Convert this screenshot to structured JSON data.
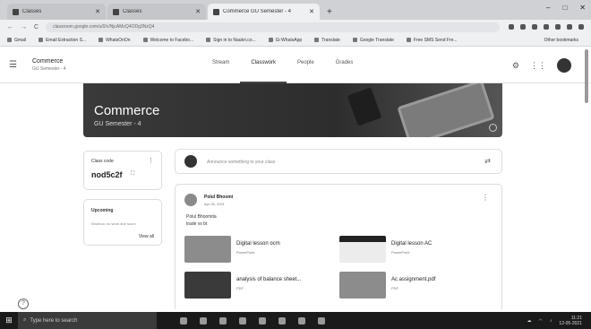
{
  "browser": {
    "tabs": [
      {
        "label": "Classes",
        "active": false
      },
      {
        "label": "Classes",
        "active": false
      },
      {
        "label": "Commerce GU Semester - 4",
        "active": true
      }
    ],
    "new_tab": "+",
    "window_controls": {
      "minimize": "–",
      "maximize": "□",
      "close": "✕"
    },
    "nav": {
      "back": "←",
      "forward": "→",
      "reload": "C"
    },
    "url": "classroom.google.com/u/0/c/NjcAMzQ4ODg3NzQ4",
    "bookmarks": [
      "Gmail",
      "Email Extraction S...",
      "WhatsOnOn",
      "Welcome to Facebo...",
      "Sign in to Naukri.co...",
      "Gi WhatsApp",
      "Translate",
      "Google Translate",
      "Free SMS Send Fre..."
    ],
    "other_bookmarks": "Other bookmarks"
  },
  "classroom": {
    "class_name": "Commerce",
    "section": "GU Semester - 4",
    "tabs": [
      {
        "label": "Stream",
        "selected": false
      },
      {
        "label": "Classwork",
        "selected": true
      },
      {
        "label": "People",
        "selected": false
      },
      {
        "label": "Grades",
        "selected": false
      }
    ],
    "banner": {
      "title": "Commerce",
      "subtitle": "GU Semester - 4"
    },
    "class_code": {
      "label": "Class code",
      "value": "nod5c2f"
    },
    "upcoming": {
      "label": "Upcoming",
      "text": "Woohoo, no work due soon!",
      "view_all": "View all"
    },
    "announce_placeholder": "Announce something to your class",
    "post": {
      "author": "Polul Bhoomi",
      "date": "Apr 26, 2021",
      "body_line1": "Polul Bhoomita",
      "body_line2": "trade vs bt",
      "attachments": [
        {
          "name": "Digital lesson ocm",
          "type": "PowerPoint"
        },
        {
          "name": "Digital lesson AC",
          "type": "PowerPoint"
        },
        {
          "name": "analysis of balance sheet...",
          "type": "PDF"
        },
        {
          "name": "Ac assignment.pdf",
          "type": "PDF"
        }
      ]
    }
  },
  "taskbar": {
    "search_placeholder": "Type here to search",
    "clock_time": "11:21",
    "clock_date": "12-05-2021"
  }
}
